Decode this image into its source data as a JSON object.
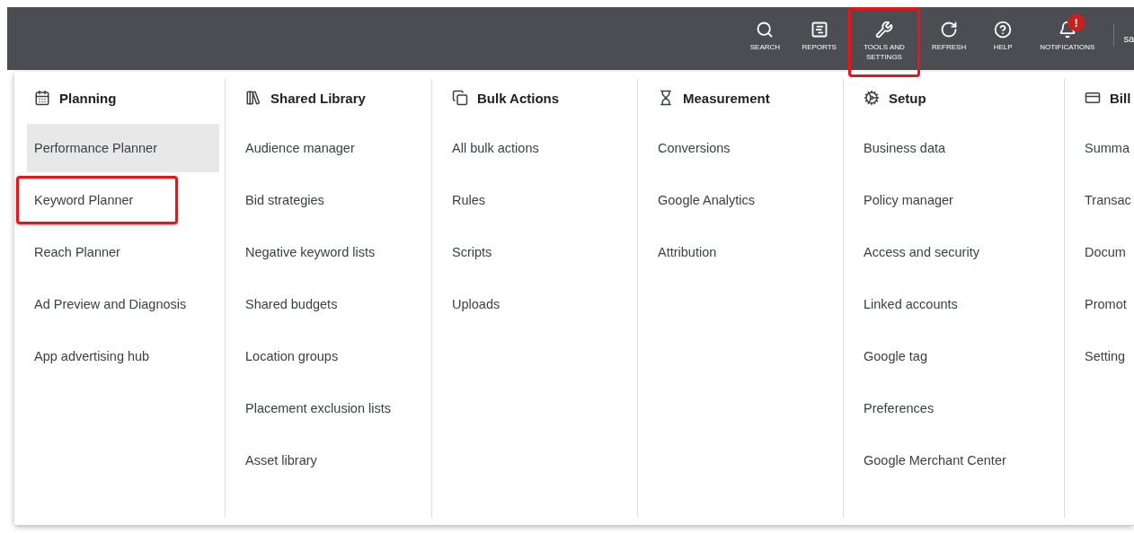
{
  "toolbar": {
    "buttons": [
      {
        "label": "SEARCH",
        "highlighted": false
      },
      {
        "label": "REPORTS",
        "highlighted": false
      },
      {
        "label": "TOOLS AND SETTINGS",
        "highlighted": true
      },
      {
        "label": "REFRESH",
        "highlighted": false
      },
      {
        "label": "HELP",
        "highlighted": false
      },
      {
        "label": "NOTIFICATIONS",
        "highlighted": false,
        "badge": "!"
      }
    ],
    "account": "sa"
  },
  "menu": {
    "columns": [
      {
        "title": "Planning",
        "items": [
          {
            "label": "Performance Planner",
            "hovered": true,
            "highlighted": false
          },
          {
            "label": "Keyword Planner",
            "hovered": false,
            "highlighted": true
          },
          {
            "label": "Reach Planner",
            "hovered": false,
            "highlighted": false
          },
          {
            "label": "Ad Preview and Diagnosis",
            "hovered": false,
            "highlighted": false
          },
          {
            "label": "App advertising hub",
            "hovered": false,
            "highlighted": false
          }
        ]
      },
      {
        "title": "Shared Library",
        "items": [
          {
            "label": "Audience manager",
            "hovered": false,
            "highlighted": false
          },
          {
            "label": "Bid strategies",
            "hovered": false,
            "highlighted": false
          },
          {
            "label": "Negative keyword lists",
            "hovered": false,
            "highlighted": false
          },
          {
            "label": "Shared budgets",
            "hovered": false,
            "highlighted": false
          },
          {
            "label": "Location groups",
            "hovered": false,
            "highlighted": false
          },
          {
            "label": "Placement exclusion lists",
            "hovered": false,
            "highlighted": false
          },
          {
            "label": "Asset library",
            "hovered": false,
            "highlighted": false
          }
        ]
      },
      {
        "title": "Bulk Actions",
        "items": [
          {
            "label": "All bulk actions",
            "hovered": false,
            "highlighted": false
          },
          {
            "label": "Rules",
            "hovered": false,
            "highlighted": false
          },
          {
            "label": "Scripts",
            "hovered": false,
            "highlighted": false
          },
          {
            "label": "Uploads",
            "hovered": false,
            "highlighted": false
          }
        ]
      },
      {
        "title": "Measurement",
        "items": [
          {
            "label": "Conversions",
            "hovered": false,
            "highlighted": false
          },
          {
            "label": "Google Analytics",
            "hovered": false,
            "highlighted": false
          },
          {
            "label": "Attribution",
            "hovered": false,
            "highlighted": false
          }
        ]
      },
      {
        "title": "Setup",
        "items": [
          {
            "label": "Business data",
            "hovered": false,
            "highlighted": false
          },
          {
            "label": "Policy manager",
            "hovered": false,
            "highlighted": false
          },
          {
            "label": "Access and security",
            "hovered": false,
            "highlighted": false
          },
          {
            "label": "Linked accounts",
            "hovered": false,
            "highlighted": false
          },
          {
            "label": "Google tag",
            "hovered": false,
            "highlighted": false
          },
          {
            "label": "Preferences",
            "hovered": false,
            "highlighted": false
          },
          {
            "label": "Google Merchant Center",
            "hovered": false,
            "highlighted": false
          }
        ]
      },
      {
        "title": "Bill",
        "items": [
          {
            "label": "Summa",
            "hovered": false,
            "highlighted": false
          },
          {
            "label": "Transac",
            "hovered": false,
            "highlighted": false
          },
          {
            "label": "Docum",
            "hovered": false,
            "highlighted": false
          },
          {
            "label": "Promot",
            "hovered": false,
            "highlighted": false
          },
          {
            "label": "Setting",
            "hovered": false,
            "highlighted": false
          }
        ]
      }
    ]
  }
}
